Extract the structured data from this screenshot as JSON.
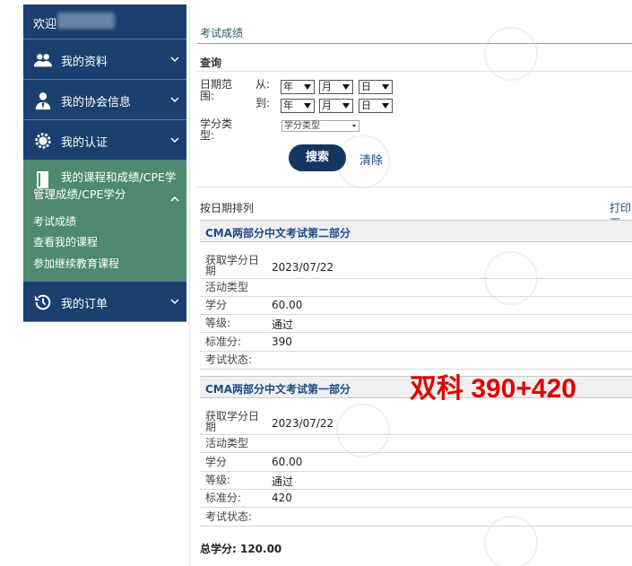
{
  "sidebar": {
    "welcome": "欢迎",
    "items": [
      {
        "label": "我的资料"
      },
      {
        "label": "我的协会信息"
      },
      {
        "label": "我的认证"
      }
    ],
    "expanded": {
      "label": "我的课程和成绩/CPE学",
      "label2": "管理成绩/CPE学分",
      "subitems": [
        "考试成绩",
        "查看我的课程",
        "参加继续教育课程"
      ]
    },
    "orders": "我的订单"
  },
  "main": {
    "title": "考试成绩",
    "query": "查询",
    "date_range_label": "日期范围:",
    "from": "从:",
    "to": "到:",
    "year": "年",
    "month": "月",
    "day": "日",
    "credit_type_label": "学分类型:",
    "credit_type_value": "学分类型",
    "search": "搜索",
    "clear": "清除",
    "sort": "按日期排列",
    "print": "打印页"
  },
  "exams": [
    {
      "title": "CMA两部分中文考试第二部分",
      "date_label": "获取学分日期",
      "date": "2023/07/22",
      "activity_label": "活动类型",
      "credit_label": "学分",
      "credit": "60.00",
      "grade_label": "等级:",
      "grade": "通过",
      "score_label": "标准分:",
      "score": "390",
      "status_label": "考试状态:"
    },
    {
      "title": "CMA两部分中文考试第一部分",
      "date_label": "获取学分日期",
      "date": "2023/07/22",
      "activity_label": "活动类型",
      "credit_label": "学分",
      "credit": "60.00",
      "grade_label": "等级:",
      "grade": "通过",
      "score_label": "标准分:",
      "score": "420",
      "status_label": "考试状态:"
    }
  ],
  "annotation": "双科 390+420",
  "total": "总学分: 120.00",
  "colors": {
    "sidebar": "#1b3f6e",
    "sidebar_active": "#4e8a70",
    "link": "#1a4b8c",
    "annotation": "#e00000"
  }
}
